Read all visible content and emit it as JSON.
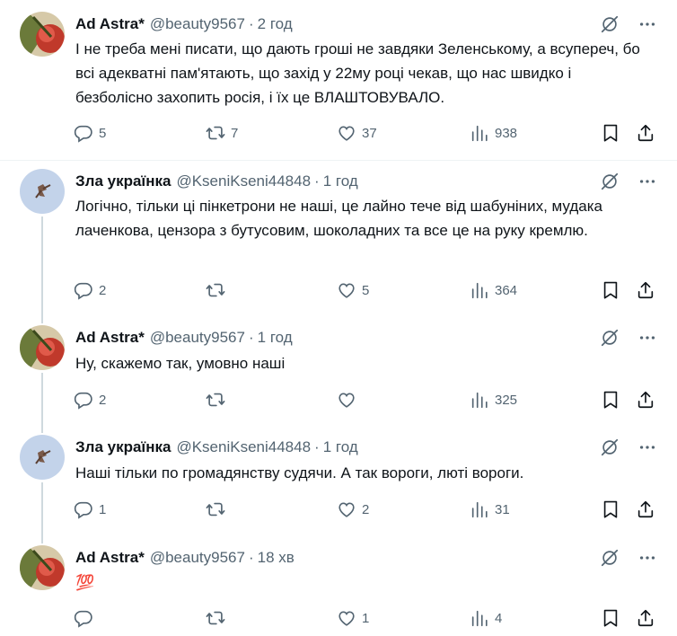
{
  "tweets": [
    {
      "name": "Ad Astra*",
      "handle": "@beauty9567",
      "time": "2 год",
      "text": "І не треба мені писати, що дають гроші не завдяки Зеленському, а всупереч, бо всі адекватні пам'ятають, що захід у 22му році чекав, що нас швидко і безболісно захопить росія, і їх це ВЛАШТОВУВАЛО.",
      "replies": "5",
      "reposts": "7",
      "likes": "37",
      "views": "938",
      "avatar": "rose"
    },
    {
      "name": "Зла українка",
      "handle": "@KseniKseni44848",
      "time": "1 год",
      "text": "Логічно, тільки ці пінкетрони не наші, це лайно тече від шабуніних, мудака лаченкова, цензора з бутусовим, шоколадних та все це на руку кремлю.",
      "replies": "2",
      "reposts": "",
      "likes": "5",
      "views": "364",
      "avatar": "bird"
    },
    {
      "name": "Ad Astra*",
      "handle": "@beauty9567",
      "time": "1 год",
      "text": "Ну, скажемо так, умовно наші",
      "replies": "2",
      "reposts": "",
      "likes": "",
      "views": "325",
      "avatar": "rose"
    },
    {
      "name": "Зла українка",
      "handle": "@KseniKseni44848",
      "time": "1 год",
      "text": "Наші тільки по громадянству судячи. А так вороги, люті вороги.",
      "replies": "1",
      "reposts": "",
      "likes": "2",
      "views": "31",
      "avatar": "bird"
    },
    {
      "name": "Ad Astra*",
      "handle": "@beauty9567",
      "time": "18 хв",
      "text": "💯",
      "replies": "",
      "reposts": "",
      "likes": "1",
      "views": "4",
      "avatar": "rose"
    }
  ],
  "colors": {
    "text": "#0f1419",
    "secondary": "#536471",
    "line": "#cfd9de",
    "divider": "#eff3f4"
  },
  "separator": "·",
  "icons": [
    "grok-icon",
    "more-icon",
    "reply-icon",
    "repost-icon",
    "like-icon",
    "views-icon",
    "bookmark-icon",
    "share-icon"
  ]
}
